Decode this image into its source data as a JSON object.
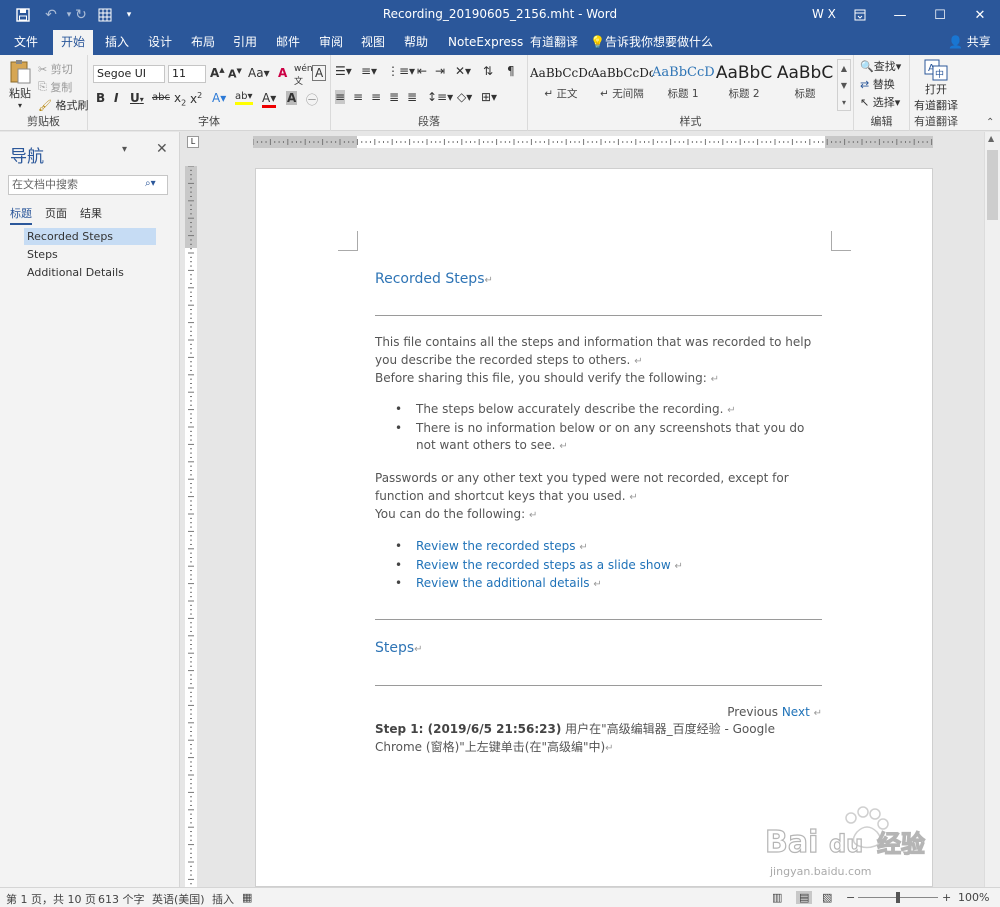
{
  "titlebar": {
    "title": "Recording_20190605_2156.mht  -  Word",
    "user": "W X",
    "restore_ribbon_icon": "ribbon-display-icon",
    "minimize": "—",
    "maximize": "☐",
    "close": "✕"
  },
  "tabs": [
    {
      "label": "文件"
    },
    {
      "label": "开始"
    },
    {
      "label": "插入"
    },
    {
      "label": "设计"
    },
    {
      "label": "布局"
    },
    {
      "label": "引用"
    },
    {
      "label": "邮件"
    },
    {
      "label": "审阅"
    },
    {
      "label": "视图"
    },
    {
      "label": "帮助"
    },
    {
      "label": "NoteExpress"
    },
    {
      "label": "有道翻译"
    }
  ],
  "tellme": "告诉我你想要做什么",
  "share": "共享",
  "ribbon": {
    "clipboard": {
      "label": "剪贴板",
      "paste": "粘贴",
      "cut": "剪切",
      "copy": "复制",
      "format_painter": "格式刷"
    },
    "font": {
      "label": "字体",
      "font_name": "Segoe UI",
      "font_size": "11"
    },
    "paragraph": {
      "label": "段落"
    },
    "styles": {
      "label": "样式",
      "items": [
        {
          "sample": "AaBbCcDc",
          "name": "↵ 正文"
        },
        {
          "sample": "AaBbCcDc",
          "name": "↵ 无间隔"
        },
        {
          "sample": "AaBbCcD",
          "name": "标题 1"
        },
        {
          "sample": "AaBbC",
          "name": "标题 2"
        },
        {
          "sample": "AaBbC",
          "name": "标题"
        }
      ]
    },
    "editing": {
      "label": "编辑",
      "find": "查找",
      "replace": "替换",
      "select": "选择"
    },
    "youdao": {
      "label": "有道翻译",
      "open": "打开",
      "open2": "有道翻译"
    }
  },
  "nav": {
    "title": "导航",
    "search_placeholder": "在文档中搜索",
    "tabs": [
      "标题",
      "页面",
      "结果"
    ],
    "items": [
      "Recorded Steps",
      "Steps",
      "Additional Details"
    ]
  },
  "doc": {
    "heading1": "Recorded Steps",
    "para1": "This file contains all the steps and information that was recorded to help you describe the recorded steps to others.",
    "para2": "Before sharing this file, you should verify the following:",
    "bullets1": [
      "The steps below accurately describe the recording.",
      "There is no information below or on any screenshots that you do not want others to see."
    ],
    "para3": "Passwords or any other text you typed were not recorded, except for function and shortcut keys that you used.",
    "para4": "You can do the following:",
    "links": [
      "Review the recorded steps",
      "Review the recorded steps as a slide show",
      "Review the additional details"
    ],
    "heading2": "Steps",
    "prev": "Previous",
    "next": "Next",
    "step1_bold": "Step 1: (2019/6/5 21:56:23)",
    "step1_text": "用户在\"高级编辑器_百度经验 - Google Chrome (窗格)\"上左键单击(在\"高级编\"中)"
  },
  "status": {
    "page": "第 1 页，共 10 页",
    "words": "613 个字",
    "lang": "英语(美国)",
    "mode": "插入",
    "zoom": "100%"
  },
  "watermark": {
    "brand": "Bai du 经验",
    "url": "jingyan.baidu.com"
  }
}
